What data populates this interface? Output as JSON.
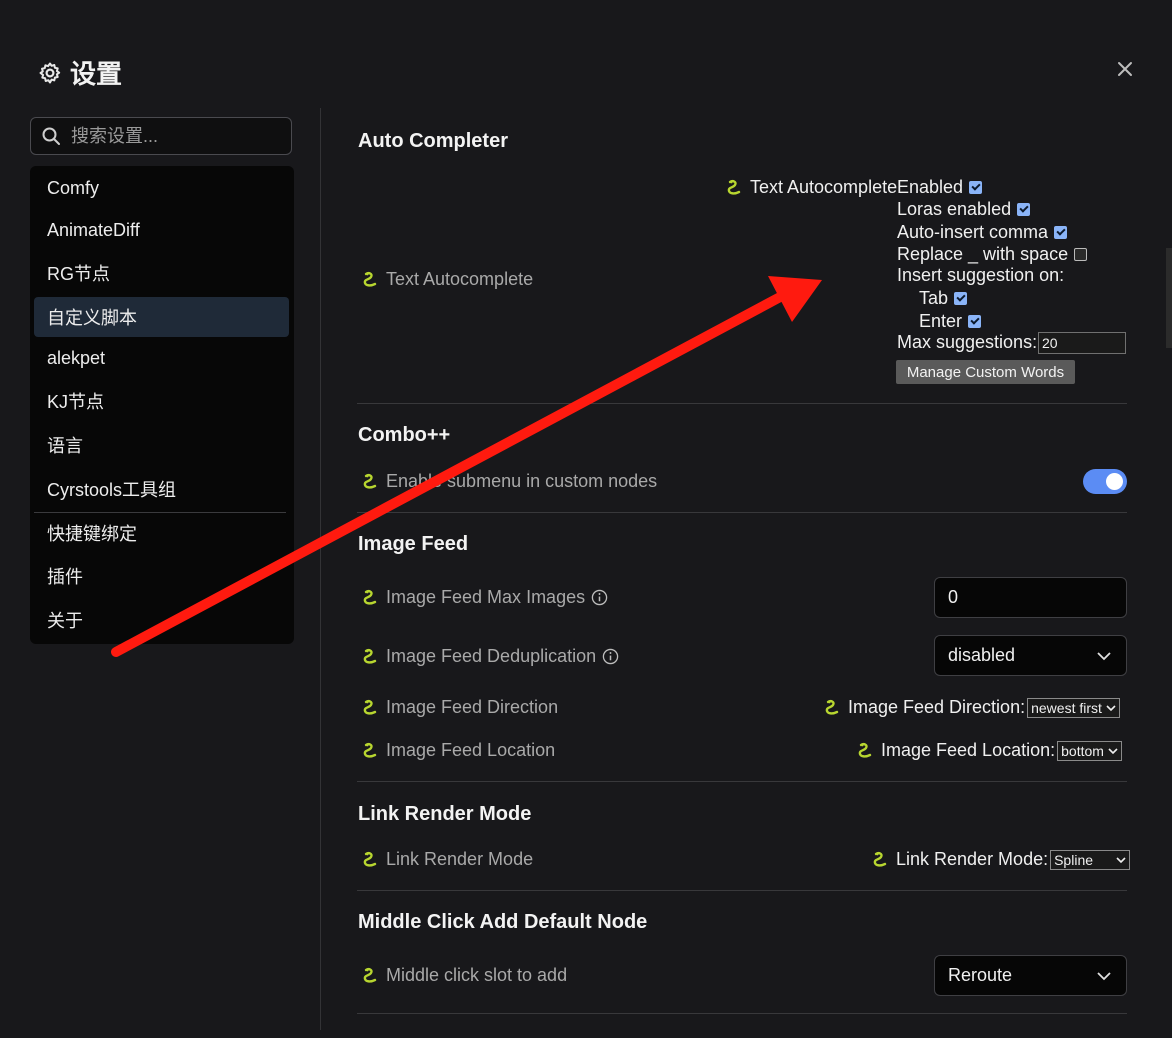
{
  "dialog": {
    "title": "设置",
    "close_glyph": "✕"
  },
  "search": {
    "placeholder": "搜索设置..."
  },
  "sidebar": {
    "items": [
      {
        "label": "Comfy"
      },
      {
        "label": "AnimateDiff"
      },
      {
        "label": "RG节点"
      },
      {
        "label": "自定义脚本",
        "active": true
      },
      {
        "label": "alekpet"
      },
      {
        "label": "KJ节点"
      },
      {
        "label": "语言"
      },
      {
        "label": "Cyrstools工具组"
      },
      {
        "label": "快捷键绑定"
      },
      {
        "label": "插件"
      },
      {
        "label": "关于"
      }
    ]
  },
  "sections": {
    "auto_completer": {
      "title": "Auto Completer",
      "row_label": "Text Autocomplete",
      "widget": {
        "head_label": "Text Autocomplete",
        "enabled_label": "Enabled",
        "enabled": true,
        "loras_label": "Loras enabled",
        "loras": true,
        "comma_label": "Auto-insert comma",
        "comma": true,
        "replace_label": "Replace _ with space",
        "replace": false,
        "insert_on_label": "Insert suggestion on:",
        "tab_label": "Tab",
        "tab": true,
        "enter_label": "Enter",
        "enter": true,
        "max_label": "Max suggestions:",
        "max_value": "20",
        "manage_button": "Manage Custom Words"
      }
    },
    "combo": {
      "title": "Combo++",
      "row_label": "Enable submenu in custom nodes",
      "toggle_on": true
    },
    "image_feed": {
      "title": "Image Feed",
      "max_images_label": "Image Feed Max Images",
      "max_images_value": "0",
      "dedup_label": "Image Feed Deduplication",
      "dedup_value": "disabled",
      "direction_label": "Image Feed Direction",
      "direction_inline_label": "Image Feed Direction:",
      "direction_value": "newest first",
      "location_label": "Image Feed Location",
      "location_inline_label": "Image Feed Location:",
      "location_value": "bottom"
    },
    "link_render": {
      "title": "Link Render Mode",
      "row_label": "Link Render Mode",
      "inline_label": "Link Render Mode:",
      "value": "Spline"
    },
    "middle_click": {
      "title": "Middle Click Add Default Node",
      "row_label": "Middle click slot to add",
      "value": "Reroute"
    }
  },
  "colors": {
    "accent": "#5b8cf4",
    "arrow": "#ff1a0f",
    "snake": "#b8d630"
  },
  "icons": [
    "gear-icon",
    "close-icon",
    "search-icon",
    "snake-icon",
    "info-icon",
    "chevron-down-icon"
  ]
}
